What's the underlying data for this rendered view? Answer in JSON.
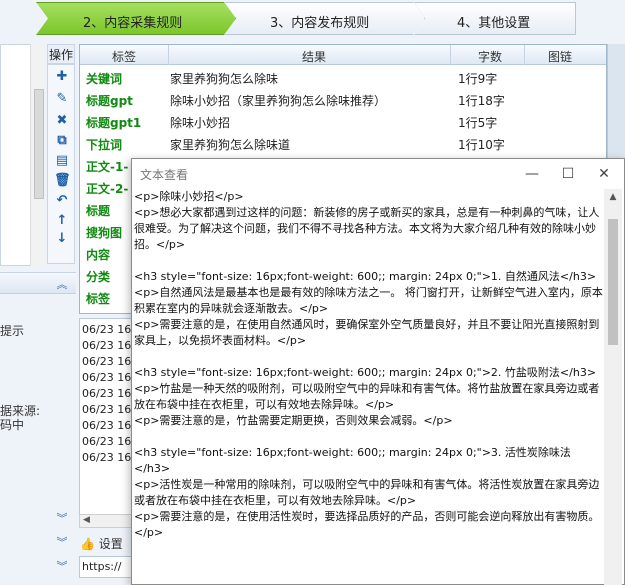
{
  "steps": [
    {
      "label": "2、内容采集规则",
      "active": true
    },
    {
      "label": "3、内容发布规则",
      "active": false
    },
    {
      "label": "4、其他设置",
      "active": false
    }
  ],
  "ops": {
    "title": "操作",
    "icons": [
      "add-icon",
      "edit-icon",
      "delete-icon",
      "copy-icon",
      "paste-icon",
      "trash-icon",
      "undo-icon",
      "move-up-icon",
      "move-down-icon"
    ]
  },
  "table": {
    "headers": {
      "tag": "标签",
      "result": "结果",
      "count": "字数",
      "image": "图链"
    },
    "rows": [
      {
        "tag": "关键词",
        "result": "家里养狗狗怎么除味",
        "count": "1行9字"
      },
      {
        "tag": "标题gpt",
        "result": "除味小妙招（家里养狗狗怎么除味推荐）",
        "count": "1行18字"
      },
      {
        "tag": "标题gpt1",
        "result": "除味小妙招",
        "count": "1行5字"
      },
      {
        "tag": "下拉词",
        "result": "家里养狗狗怎么除味道",
        "count": "1行10字"
      },
      {
        "tag": "正文-1-",
        "result": "",
        "count": ""
      },
      {
        "tag": "正文-2-",
        "result": "",
        "count": ""
      },
      {
        "tag": "标题",
        "result": "",
        "count": ""
      },
      {
        "tag": "搜狗图",
        "result": "",
        "count": ""
      },
      {
        "tag": "内容",
        "result": "",
        "count": ""
      },
      {
        "tag": "分类",
        "result": "",
        "count": ""
      },
      {
        "tag": "标签",
        "result": "",
        "count": ""
      }
    ]
  },
  "left_fragments": {
    "frag1": "提示",
    "frag2": "据来源:",
    "frag3": "码中"
  },
  "log": {
    "lines": [
      "06/23 16",
      "06/23 16",
      "06/23 16",
      "06/23 16",
      "06/23 16",
      "06/23 16",
      "06/23 16",
      "06/23 16",
      "06/23 16"
    ]
  },
  "settings_link": "设置",
  "url_value": "https://",
  "dialog": {
    "title": "文本查看",
    "content": "<p>除味小妙招</p>\n<p>想必大家都遇到过这样的问题：新装修的房子或新买的家具，总是有一种刺鼻的气味，让人很难受。为了解决这个问题，我们不得不寻找各种方法。本文将为大家介绍几种有效的除味小妙招。</p>\n\n<h3 style=\"font-size: 16px;font-weight: 600;; margin: 24px 0;\">1. 自然通风法</h3>\n<p>自然通风法是最基本也是最有效的除味方法之一。 将门窗打开，让新鲜空气进入室内，原本积累在室内的异味就会逐渐散去。</p>\n<p>需要注意的是，在使用自然通风时，要确保室外空气质量良好，并且不要让阳光直接照射到家具上，以免损坏表面材料。</p>\n\n<h3 style=\"font-size: 16px;font-weight: 600;; margin: 24px 0;\">2. 竹盐吸附法</h3>\n<p>竹盐是一种天然的吸附剂，可以吸附空气中的异味和有害气体。将竹盐放置在家具旁边或者放在布袋中挂在衣柜里，可以有效地去除异味。</p>\n<p>需要注意的是，竹盐需要定期更换，否则效果会减弱。</p>\n\n<h3 style=\"font-size: 16px;font-weight: 600;; margin: 24px 0;\">3. 活性炭除味法</h3>\n<p>活性炭是一种常用的除味剂，可以吸附空气中的异味和有害气体。将活性炭放置在家具旁边或者放在布袋中挂在衣柜里，可以有效地去除异味。</p>\n<p>需要注意的是，在使用活性炭时，要选择品质好的产品，否则可能会逆向释放出有害物质。</p>"
  },
  "colors": {
    "active_step": "#7cc62b",
    "tag_text": "#118a11",
    "op_icon": "#1f5fa7"
  }
}
